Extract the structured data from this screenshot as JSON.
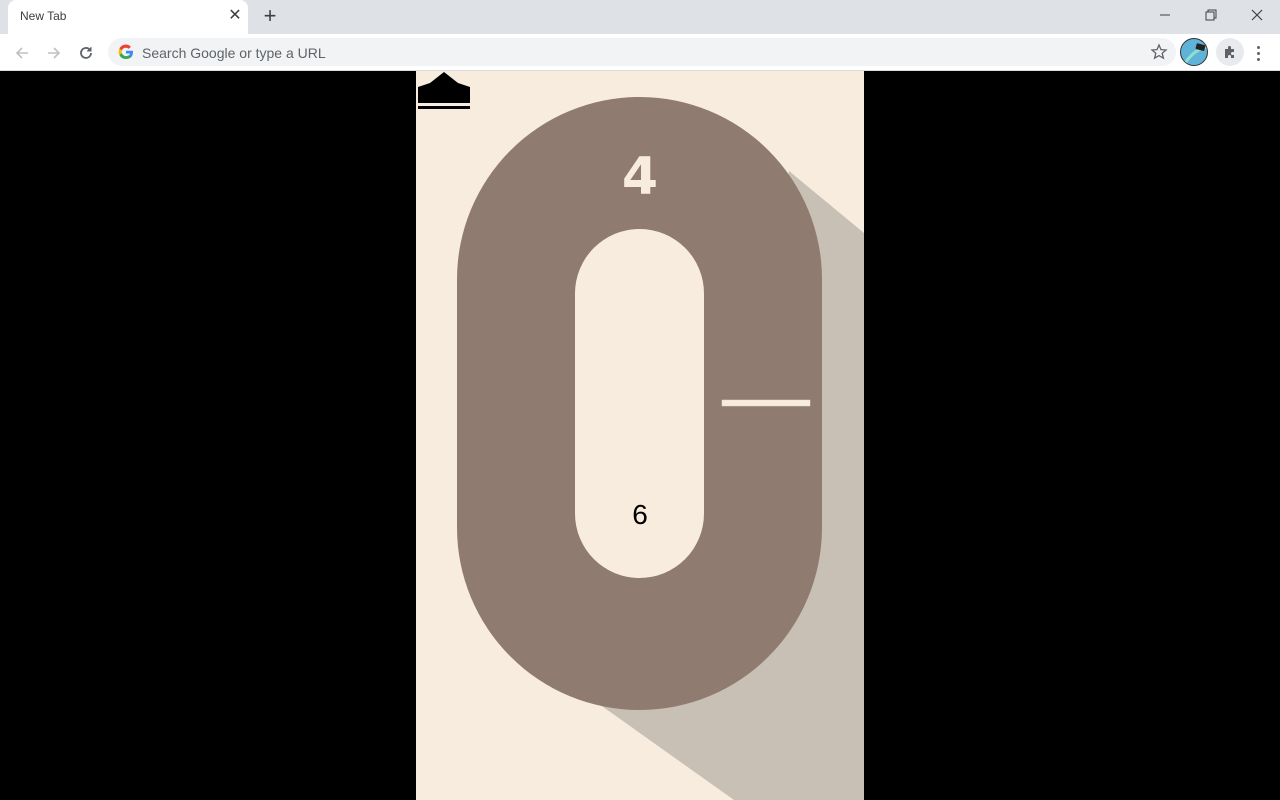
{
  "browser": {
    "tab_title": "New Tab",
    "omnibox_placeholder": "Search Google or type a URL",
    "icons": [
      "back-arrow-icon",
      "forward-arrow-icon",
      "reload-icon",
      "google-g-icon",
      "bookmark-star-icon",
      "profile-avatar-icon",
      "extensions-puzzle-icon",
      "kebab-menu-icon",
      "minimize-icon",
      "restore-icon",
      "close-icon",
      "new-tab-plus-icon",
      "tab-close-icon"
    ]
  },
  "game": {
    "score": "4",
    "best_score": "6",
    "best_icon": "crown-icon",
    "colors": {
      "background": "#f8ecdf",
      "track": "#8f7b6f",
      "shadow": "#c8bfb5",
      "player_bar": "#f8ecdf",
      "text_dark": "#000000"
    }
  }
}
